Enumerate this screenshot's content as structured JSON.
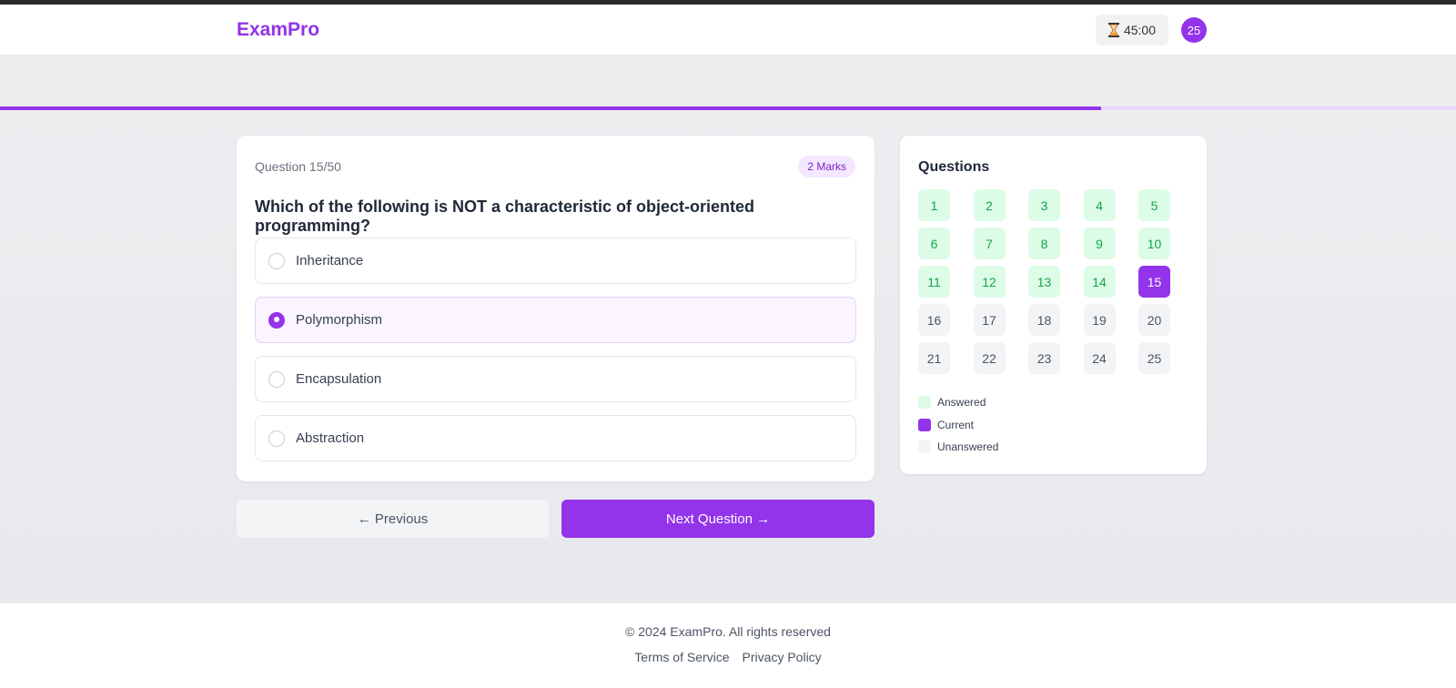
{
  "header": {
    "brand": "ExamPro",
    "timer_icon": "hourglass-icon",
    "timer": "45:00",
    "avatar": "25"
  },
  "progress": {
    "fraction": 0.756
  },
  "question": {
    "number_label": "Question 15/50",
    "marks": "2 Marks",
    "text": "Which of the following is NOT a characteristic of object-oriented programming?",
    "options": [
      {
        "label": "Inheritance",
        "selected": false
      },
      {
        "label": "Polymorphism",
        "selected": true
      },
      {
        "label": "Encapsulation",
        "selected": false
      },
      {
        "label": "Abstraction",
        "selected": false
      }
    ]
  },
  "navigation": {
    "previous": "← Previous",
    "next": "Next Question →"
  },
  "panel": {
    "title": "Questions",
    "questions": [
      {
        "n": "1",
        "status": "answered"
      },
      {
        "n": "2",
        "status": "answered"
      },
      {
        "n": "3",
        "status": "answered"
      },
      {
        "n": "4",
        "status": "answered"
      },
      {
        "n": "5",
        "status": "answered"
      },
      {
        "n": "6",
        "status": "answered"
      },
      {
        "n": "7",
        "status": "answered"
      },
      {
        "n": "8",
        "status": "answered"
      },
      {
        "n": "9",
        "status": "answered"
      },
      {
        "n": "10",
        "status": "answered"
      },
      {
        "n": "11",
        "status": "answered"
      },
      {
        "n": "12",
        "status": "answered"
      },
      {
        "n": "13",
        "status": "answered"
      },
      {
        "n": "14",
        "status": "answered"
      },
      {
        "n": "15",
        "status": "current"
      },
      {
        "n": "16",
        "status": "unanswered"
      },
      {
        "n": "17",
        "status": "unanswered"
      },
      {
        "n": "18",
        "status": "unanswered"
      },
      {
        "n": "19",
        "status": "unanswered"
      },
      {
        "n": "20",
        "status": "unanswered"
      },
      {
        "n": "21",
        "status": "unanswered"
      },
      {
        "n": "22",
        "status": "unanswered"
      },
      {
        "n": "23",
        "status": "unanswered"
      },
      {
        "n": "24",
        "status": "unanswered"
      },
      {
        "n": "25",
        "status": "unanswered"
      }
    ],
    "legend": {
      "answered": "Answered",
      "current": "Current",
      "unanswered": "Unanswered"
    }
  },
  "footer": {
    "copyright": "© 2024 ExamPro. All rights reserved",
    "links": [
      "Terms of Service",
      "Privacy Policy"
    ]
  },
  "colors": {
    "accent": "#9333ea",
    "answered_bg": "#dcfce7",
    "answered_text": "#16a34a",
    "unanswered_bg": "#f3f4f6"
  }
}
